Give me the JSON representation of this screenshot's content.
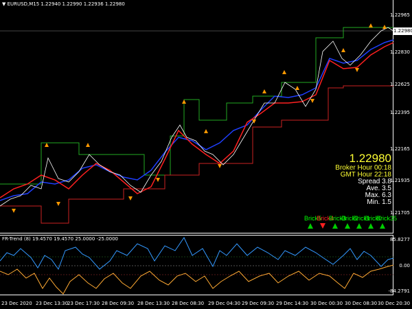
{
  "header": {
    "symbol_line": "▼ EURUSD,M15  1.22940 1.22990 1.22936 1.22980"
  },
  "price_axis": {
    "ticks": [
      "1.22965",
      "1.22830",
      "1.22625",
      "1.22395",
      "1.22165",
      "1.21935",
      "1.21705"
    ],
    "current_price": "1.22980"
  },
  "time_axis": {
    "ticks": [
      "23 Dec 2020",
      "23 Dec 13:30",
      "23 Dec 17:30",
      "28 Dec 09:30",
      "28 Dec 13:30",
      "28 Dec 08:30",
      "29 Dec 04:30",
      "29 Dec 09:30",
      "29 Dec 14:30",
      "30 Dec 00:30",
      "30 Dec 08:30",
      "30 Dec 20:30"
    ]
  },
  "info_panel": {
    "price": "1.22980",
    "broker_hour": "Broker Hour  00:18",
    "gmt_hour": "GMT Hour  22:18",
    "spread": "Spread 3.8",
    "ave": "Ave.  3.5",
    "max": "Max. 6.3",
    "min": "Min. 1.5"
  },
  "bricks": [
    {
      "label": "Brick5",
      "color": "#00ff00"
    },
    {
      "label": "Brick4",
      "color": "#ff2020"
    },
    {
      "label": "Brick3",
      "color": "#00ff00"
    },
    {
      "label": "Brick2",
      "color": "#00ff00"
    },
    {
      "label": "Brick1",
      "color": "#00ff00"
    },
    {
      "label": "Brick0",
      "color": "#00ff00"
    },
    {
      "label": "Brick35",
      "color": "#00ff00"
    }
  ],
  "sub_window": {
    "title": "FR-Trend (8) 19.4570 19.4570 25.0000 -25.0000",
    "ticks": [
      "85.8277",
      "0.00",
      "-84.2791"
    ]
  },
  "colors": {
    "background": "#000000",
    "upper_line": "#1f3fff",
    "lower_line": "#ff2020",
    "step_up": "#22aa22",
    "step_down": "#cc2222",
    "oscillator_up": "#3399ff",
    "oscillator_down": "#ffaa33"
  }
}
